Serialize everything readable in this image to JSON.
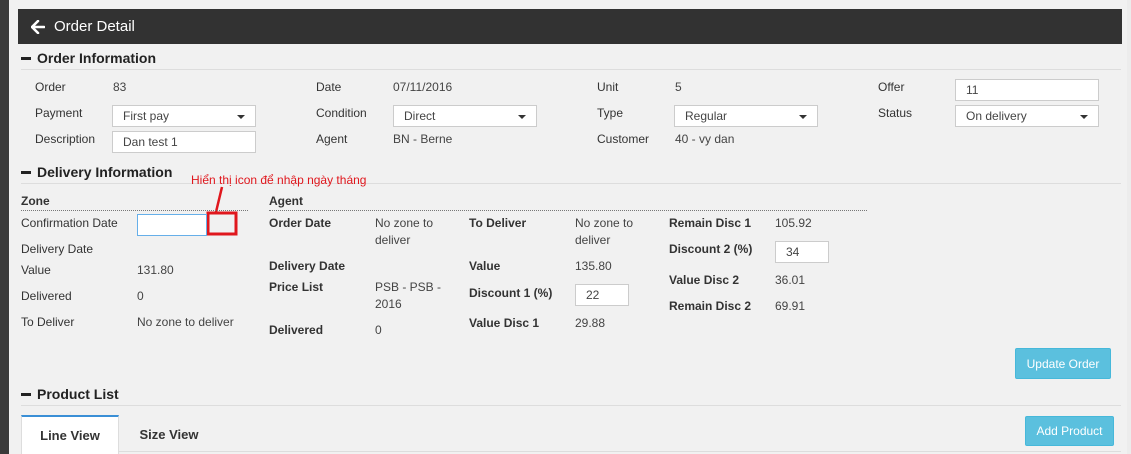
{
  "header": {
    "title": "Order Detail",
    "back_icon": "arrow-left-icon"
  },
  "order_info": {
    "title": "Order Information",
    "order_label": "Order",
    "order_value": "83",
    "date_label": "Date",
    "date_value": "07/11/2016",
    "unit_label": "Unit",
    "unit_value": "5",
    "offer_label": "Offer",
    "offer_value": "11",
    "payment_label": "Payment",
    "payment_value": "First pay",
    "condition_label": "Condition",
    "condition_value": "Direct",
    "type_label": "Type",
    "type_value": "Regular",
    "status_label": "Status",
    "status_value": "On delivery",
    "description_label": "Description",
    "description_value": "Dan test 1",
    "agent_label": "Agent",
    "agent_value": "BN - Berne",
    "customer_label": "Customer",
    "customer_value": "40 - vy dan"
  },
  "delivery_info": {
    "title": "Delivery Information",
    "annotation": "Hiển thị icon để nhập ngày tháng",
    "zone": {
      "header": "Zone",
      "confirmation_date_label": "Confirmation Date",
      "confirmation_date_value": "",
      "delivery_date_label": "Delivery Date",
      "value_label": "Value",
      "value_value": "131.80",
      "delivered_label": "Delivered",
      "delivered_value": "0",
      "to_deliver_label": "To Deliver",
      "to_deliver_value": "No zone to deliver"
    },
    "agent": {
      "header": "Agent",
      "order_date_label": "Order Date",
      "order_date_value": "No zone to deliver",
      "delivery_date_label": "Delivery Date",
      "price_list_label": "Price List",
      "price_list_value": "PSB - PSB - 2016",
      "delivered_label": "Delivered",
      "delivered_value": "0",
      "to_deliver_label": "To Deliver",
      "to_deliver_value": "No zone to deliver",
      "value_label": "Value",
      "value_value": "135.80",
      "discount1_label": "Discount 1 (%)",
      "discount1_value": "22",
      "value_disc1_label": "Value Disc 1",
      "value_disc1_value": "29.88",
      "remain_disc1_label": "Remain Disc 1",
      "remain_disc1_value": "105.92",
      "discount2_label": "Discount 2 (%)",
      "discount2_value": "34",
      "value_disc2_label": "Value Disc 2",
      "value_disc2_value": "36.01",
      "remain_disc2_label": "Remain Disc 2",
      "remain_disc2_value": "69.91"
    },
    "update_button": "Update Order"
  },
  "product_list": {
    "title": "Product List",
    "tabs": [
      "Line View",
      "Size View"
    ],
    "add_button": "Add Product"
  },
  "colors": {
    "header_bg": "#323232",
    "accent": "#5bc0de",
    "annotation": "#e0171d",
    "tab_active": "#3a8fd6"
  }
}
